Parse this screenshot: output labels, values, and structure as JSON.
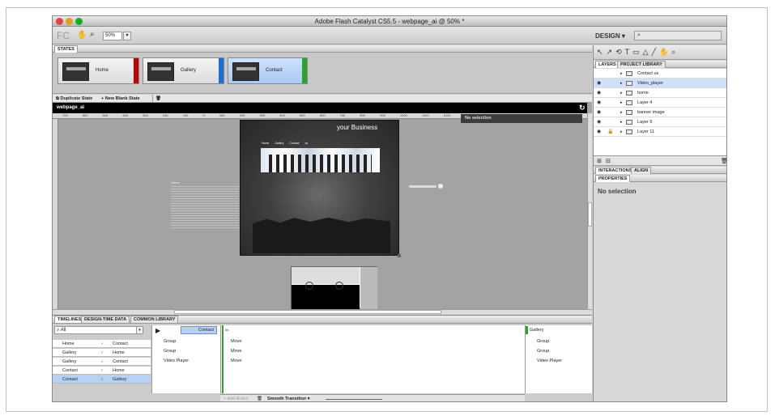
{
  "window": {
    "title": "Adobe Flash Catalyst CS5.5 - webpage_ai @ 50% *"
  },
  "toolbar": {
    "logo": "FC",
    "zoom": "50%",
    "workspace": "DESIGN",
    "search_placeholder": ""
  },
  "states": {
    "tab": "STATES",
    "items": [
      {
        "label": "Home",
        "color": "#c00000"
      },
      {
        "label": "Gallery",
        "color": "#1a6fd1"
      },
      {
        "label": "Contact",
        "color": "#2aa52a",
        "selected": true
      }
    ],
    "duplicate": "Duplicate State",
    "new_blank": "New Blank State"
  },
  "canvas": {
    "doc_tab": "webpage_ai",
    "no_selection": "No selection",
    "ruler_ticks": [
      "700",
      "600",
      "500",
      "400",
      "300",
      "200",
      "100",
      "0",
      "100",
      "200",
      "300",
      "400",
      "500",
      "600",
      "700",
      "800",
      "900",
      "1000",
      "1100",
      "1200",
      "1300",
      "1400"
    ],
    "artboard": {
      "headline": "your Business",
      "nav": [
        "Home",
        "Gallery",
        "Contact us"
      ],
      "side_title": "Home"
    }
  },
  "timelines": {
    "tabs": [
      "TIMELINES",
      "DESIGN-TIME DATA",
      "COMMON LIBRARY"
    ],
    "filter": "All",
    "transitions": [
      {
        "from": "Home",
        "to": "Contact"
      },
      {
        "from": "Gallery",
        "to": "Home"
      },
      {
        "from": "Gallery",
        "to": "Contact"
      },
      {
        "from": "Contact",
        "to": "Home"
      },
      {
        "from": "Contact",
        "to": "Gallery",
        "selected": true
      }
    ],
    "source_state": "Contact",
    "target_state": "Gallery",
    "time_label": "0s",
    "left_objects": [
      "Group",
      "Group",
      "Video Player"
    ],
    "actions": [
      "Move",
      "Move",
      "Move"
    ],
    "right_objects": [
      "Group",
      "Group",
      "Video Player"
    ],
    "add_action": "Add Action",
    "smooth_transition": "Smooth Transition"
  },
  "layers": {
    "tabs": [
      "LAYERS",
      "PROJECT LIBRARY"
    ],
    "items": [
      {
        "name": "Contact us",
        "visible": false
      },
      {
        "name": "Video_player",
        "visible": true,
        "selected": true
      },
      {
        "name": "home",
        "visible": true
      },
      {
        "name": "Layer 4",
        "visible": true
      },
      {
        "name": "banner image",
        "visible": true
      },
      {
        "name": "Layer 9",
        "visible": true
      },
      {
        "name": "Layer 11",
        "visible": true,
        "locked": true
      }
    ]
  },
  "interactions": {
    "tabs": [
      "INTERACTIONS",
      "ALIGN"
    ]
  },
  "properties": {
    "tab": "PROPERTIES",
    "status": "No selection"
  }
}
